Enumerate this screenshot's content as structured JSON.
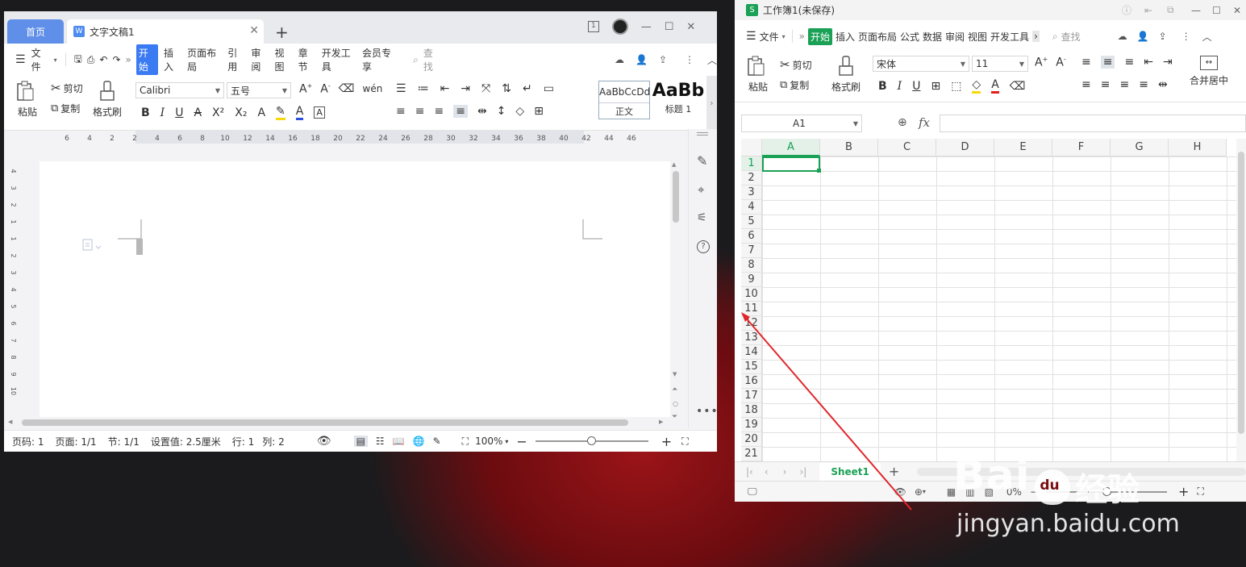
{
  "writer": {
    "tabs": {
      "home": "首页",
      "doc": "文字文稿1"
    },
    "menu": [
      "文件",
      "开始",
      "插入",
      "页面布局",
      "引用",
      "审阅",
      "视图",
      "章节",
      "开发工具",
      "会员专享"
    ],
    "search": "查找",
    "ribbon": {
      "paste": "粘贴",
      "cut": "剪切",
      "copy": "复制",
      "format_painter": "格式刷",
      "font": "Calibri",
      "size": "五号",
      "style_normal_sample": "AaBbCcDd",
      "style_normal": "正文",
      "style_h1_sample": "AaBb",
      "style_h1": "标题 1"
    },
    "ruler": [
      "6",
      "4",
      "2",
      "2",
      "4",
      "6",
      "8",
      "10",
      "12",
      "14",
      "16",
      "18",
      "20",
      "22",
      "24",
      "26",
      "28",
      "30",
      "32",
      "34",
      "36",
      "38",
      "40",
      "42",
      "44",
      "46"
    ],
    "vruler": [
      "4",
      "3",
      "2",
      "1",
      "1",
      "2",
      "3",
      "4",
      "5",
      "6",
      "7",
      "8",
      "9",
      "10"
    ],
    "status": {
      "page_no": "页码: 1",
      "pages": "页面: 1/1",
      "section": "节: 1/1",
      "setting": "设置值: 2.5厘米",
      "row": "行: 1",
      "col": "列: 2",
      "zoom": "100%"
    }
  },
  "sheet": {
    "title": "工作簿1(未保存)",
    "menu": [
      "文件",
      "开始",
      "插入",
      "页面布局",
      "公式",
      "数据",
      "审阅",
      "视图",
      "开发工具"
    ],
    "search": "查找",
    "ribbon": {
      "paste": "粘贴",
      "cut": "剪切",
      "copy": "复制",
      "format_painter": "格式刷",
      "font": "宋体",
      "size": "11",
      "merge": "合并居中"
    },
    "cell_ref": "A1",
    "fx": "fx",
    "columns": [
      "A",
      "B",
      "C",
      "D",
      "E",
      "F",
      "G",
      "H"
    ],
    "rows": [
      "1",
      "2",
      "3",
      "4",
      "5",
      "6",
      "7",
      "8",
      "9",
      "10",
      "11",
      "12",
      "13",
      "14",
      "15",
      "16",
      "17",
      "18",
      "19",
      "20",
      "21"
    ],
    "sheet_tab": "Sheet1",
    "zoom": "0%"
  },
  "watermark": {
    "brand": "Bai",
    "paw": "du",
    "jingyan": "经验",
    "url": "jingyan.baidu.com"
  },
  "colors": {
    "writer_accent": "#3a7af2",
    "sheet_accent": "#1aa156",
    "arrow": "#e0262b"
  }
}
